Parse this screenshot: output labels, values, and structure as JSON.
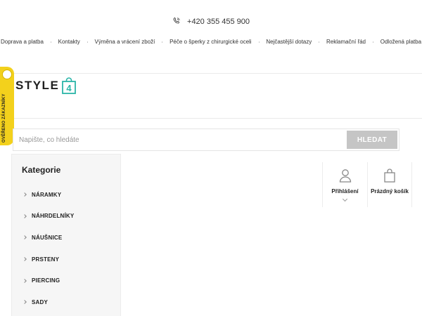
{
  "header": {
    "phone": "+420 355 455 900",
    "nav": [
      "Doprava a platba",
      "Kontakty",
      "Výměna a vrácení zboží",
      "Péče o šperky z chirurgické oceli",
      "Nejčastější dotazy",
      "Reklamační řád",
      "Odložená platba"
    ]
  },
  "badge": {
    "label": "OVĚŘENO ZÁKAZNÍKY"
  },
  "logo": {
    "text": "STYLE",
    "bag_digit": "4",
    "accent_color": "#2bb5a8"
  },
  "search": {
    "placeholder": "Napište, co hledáte",
    "value": "",
    "button_label": "HLEDAT"
  },
  "sidebar": {
    "title": "Kategorie",
    "items": [
      "NÁRAMKY",
      "NÁHRDELNÍKY",
      "NÁUŠNICE",
      "PRSTENY",
      "PIERCING",
      "SADY"
    ]
  },
  "account": {
    "login_label": "Přihlášení",
    "cart_label": "Prázdný košík"
  }
}
